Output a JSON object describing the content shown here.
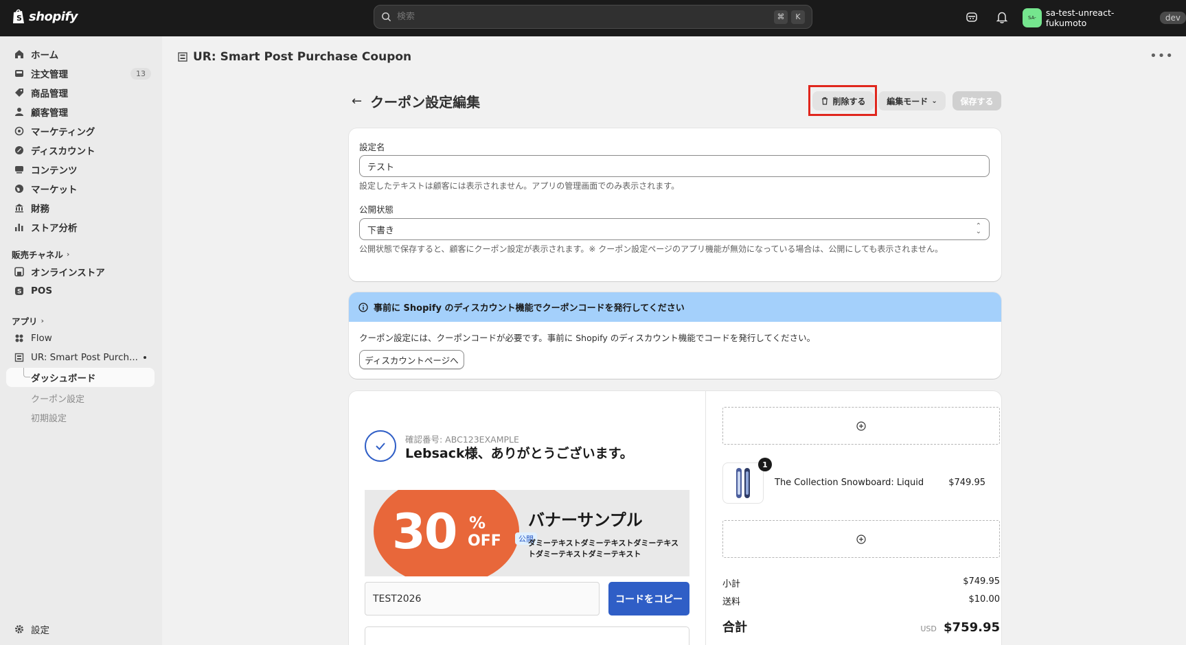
{
  "topbar": {
    "logo_text": "shopify",
    "search_placeholder": "検索",
    "search_key1": "⌘",
    "search_key2": "K",
    "store_name": "sa-test-unreact-fukumoto",
    "avatar_initials": "SA-",
    "dev_label": "dev"
  },
  "sidebar": {
    "items": [
      {
        "label": "ホーム",
        "icon": "home-icon"
      },
      {
        "label": "注文管理",
        "icon": "inbox-icon",
        "count": "13"
      },
      {
        "label": "商品管理",
        "icon": "tag-icon"
      },
      {
        "label": "顧客管理",
        "icon": "person-icon"
      },
      {
        "label": "マーケティング",
        "icon": "target-icon"
      },
      {
        "label": "ディスカウント",
        "icon": "discount-icon"
      },
      {
        "label": "コンテンツ",
        "icon": "content-icon"
      },
      {
        "label": "マーケット",
        "icon": "globe-icon"
      },
      {
        "label": "財務",
        "icon": "bank-icon"
      },
      {
        "label": "ストア分析",
        "icon": "chart-icon"
      }
    ],
    "sales_channels_label": "販売チャネル",
    "channels": [
      {
        "label": "オンラインストア",
        "icon": "store-icon"
      },
      {
        "label": "POS",
        "icon": "pos-icon"
      }
    ],
    "apps_label": "アプリ",
    "apps": [
      {
        "label": "Flow",
        "icon": "flow-icon"
      },
      {
        "label": "UR: Smart Post Purch...",
        "icon": "app-icon"
      }
    ],
    "app_sub": {
      "dashboard": "ダッシュボード",
      "coupon_settings": "クーポン設定",
      "initial_settings": "初期設定"
    },
    "settings_label": "設定"
  },
  "header": {
    "app_title": "UR: Smart Post Purchase Coupon",
    "page_title": "クーポン設定編集",
    "delete_label": "削除する",
    "mode_label": "編集モード",
    "save_label": "保存する"
  },
  "form": {
    "name_label": "設定名",
    "name_value": "テスト",
    "name_help": "設定したテキストは顧客には表示されません。アプリの管理画面でのみ表示されます。",
    "status_label": "公開状態",
    "status_value": "下書き",
    "status_help": "公開状態で保存すると、顧客にクーポン設定が表示されます。※ クーポン設定ページのアプリ機能が無効になっている場合は、公開にしても表示されません。"
  },
  "notice": {
    "title": "事前に Shopify のディスカウント機能でクーポンコードを発行してください",
    "body": "クーポン設定には、クーポンコードが必要です。事前に Shopify のディスカウント機能でコードを発行してください。",
    "button_label": "ディスカウントページへ"
  },
  "preview": {
    "confirm_no": "確認番号: ABC123EXAMPLE",
    "thanks": "Lebsack様、ありがとうございます。",
    "banner_number": "30",
    "banner_pct": "%",
    "banner_off": "OFF",
    "banner_title": "バナーサンプル",
    "banner_desc": "ダミーテキストダミーテキストダミーテキストダミーテキストダミーテキスト",
    "pub_tag": "公開",
    "code": "TEST2026",
    "copy_label": "コードをコピー",
    "product_name": "The Collection Snowboard: Liquid",
    "product_price": "$749.95",
    "qty": "1",
    "subtotal_label": "小計",
    "subtotal_value": "$749.95",
    "shipping_label": "送料",
    "shipping_value": "$10.00",
    "total_label": "合計",
    "total_currency": "USD",
    "total_value": "$759.95"
  },
  "colors": {
    "topbar": "#1a1a1a",
    "notice_bg": "#a4d0fb",
    "coupon_orange": "#e8673a",
    "copy_blue": "#2f5ec6",
    "highlight_red": "#e0261d"
  }
}
